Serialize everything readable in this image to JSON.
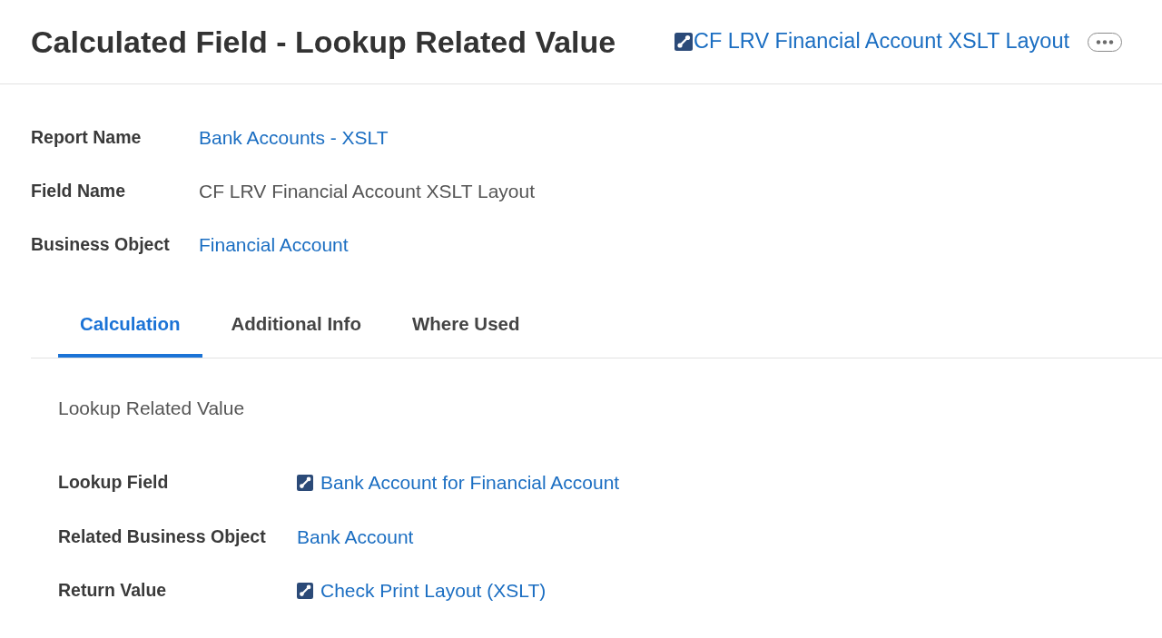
{
  "header": {
    "title": "Calculated Field - Lookup Related Value",
    "link": {
      "text": "CF LRV Financial Account XSLT Layout",
      "kind": "icon_link"
    }
  },
  "details": [
    {
      "label": "Report Name",
      "value": "Bank Accounts - XSLT",
      "kind": "link"
    },
    {
      "label": "Field Name",
      "value": "CF LRV Financial Account XSLT Layout",
      "kind": "text"
    },
    {
      "label": "Business Object",
      "value": "Financial Account",
      "kind": "link"
    }
  ],
  "tabs": [
    {
      "label": "Calculation",
      "selected": true
    },
    {
      "label": "Additional Info",
      "selected": false
    },
    {
      "label": "Where Used",
      "selected": false
    }
  ],
  "calculation": {
    "heading": "Lookup Related Value",
    "fields": [
      {
        "label": "Lookup Field",
        "value": "Bank Account for Financial Account",
        "kind": "icon_link"
      },
      {
        "label": "Related Business Object",
        "value": "Bank Account",
        "kind": "link"
      },
      {
        "label": "Return Value",
        "value": "Check Print Layout (XSLT)",
        "kind": "icon_link"
      }
    ]
  }
}
